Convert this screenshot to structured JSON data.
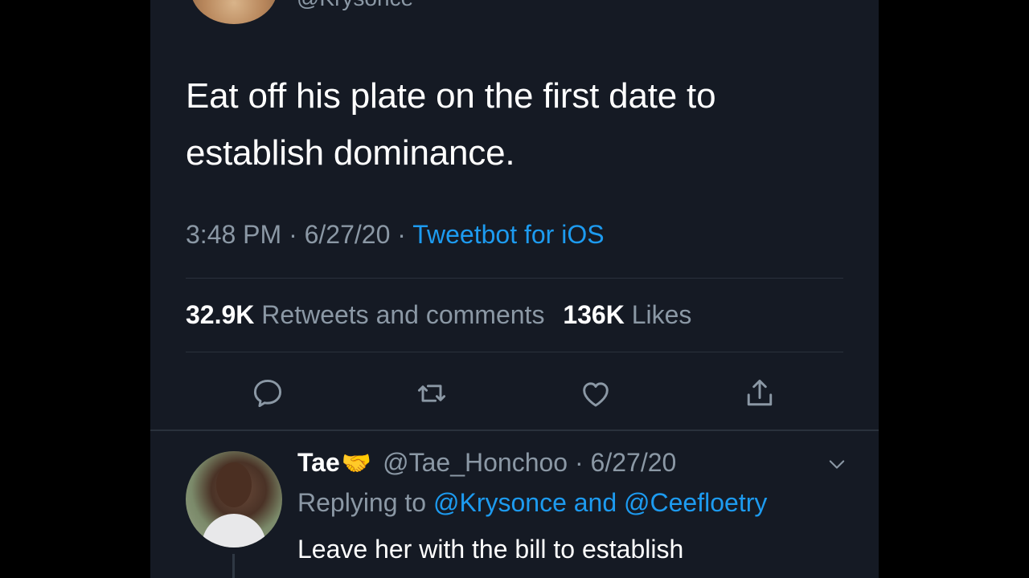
{
  "main_tweet": {
    "handle_partial": "@Krysonce",
    "text": "Eat off his plate on the first date to establish dominance.",
    "time": "3:48 PM",
    "date": "6/27/20",
    "separator": "·",
    "source": "Tweetbot for iOS",
    "retweets_count": "32.9K",
    "retweets_label": "Retweets and comments",
    "likes_count": "136K",
    "likes_label": "Likes"
  },
  "actions": {
    "reply_icon": "reply-icon",
    "retweet_icon": "retweet-icon",
    "like_icon": "heart-icon",
    "share_icon": "share-icon"
  },
  "reply": {
    "name": "Tae",
    "emoji": "🤝",
    "handle": "@Tae_Honchoo",
    "separator": "·",
    "date": "6/27/20",
    "replying_prefix": "Replying to",
    "mentions": "@Krysonce and @Ceefloetry",
    "text": "Leave her with the bill to establish"
  },
  "colors": {
    "background": "#151a24",
    "accent": "#1d9bf0",
    "secondary_text": "#8b98a5",
    "primary_text": "#ffffff"
  }
}
